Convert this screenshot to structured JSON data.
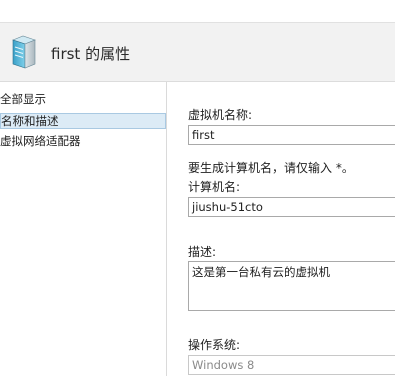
{
  "header": {
    "title": "first 的属性",
    "icon": "server-icon"
  },
  "nav": {
    "items": [
      {
        "label": "全部显示"
      },
      {
        "label": "名称和描述",
        "selected": true
      },
      {
        "label": "虚拟网络适配器"
      }
    ]
  },
  "form": {
    "vm_name_label": "虚拟机名称:",
    "vm_name_value": "first",
    "hint_text": "要生成计算机名，请仅输入 *。",
    "computer_name_label": "计算机名:",
    "computer_name_value": "jiushu-51cto",
    "description_label": "描述:",
    "description_value": "这是第一台私有云的虚拟机",
    "os_label": "操作系统:",
    "os_value": "Windows 8"
  },
  "colors": {
    "selection_bg": "#dcebf6",
    "selection_border": "#a9c9e2",
    "header_bg": "#f2f2f2"
  }
}
